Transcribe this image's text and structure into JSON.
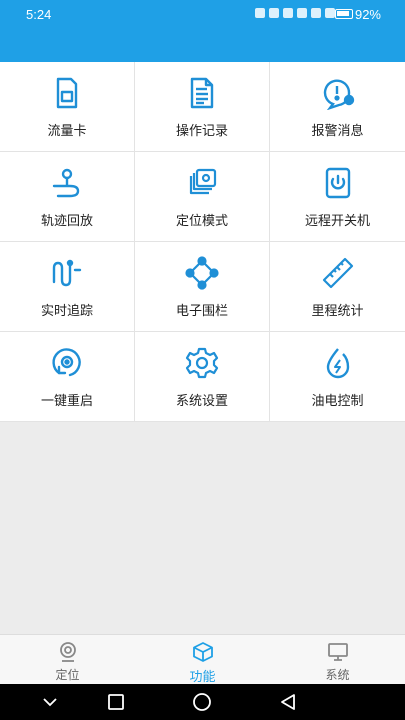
{
  "status_bar": {
    "time": "5:24",
    "battery_percent": "92%"
  },
  "features": [
    {
      "label": "流量卡",
      "icon": "sim-card-icon"
    },
    {
      "label": "操作记录",
      "icon": "document-icon"
    },
    {
      "label": "报警消息",
      "icon": "alarm-message-icon"
    },
    {
      "label": "轨迹回放",
      "icon": "track-playback-icon"
    },
    {
      "label": "定位模式",
      "icon": "location-mode-icon"
    },
    {
      "label": "远程开关机",
      "icon": "power-icon"
    },
    {
      "label": "实时追踪",
      "icon": "realtime-tracking-icon"
    },
    {
      "label": "电子围栏",
      "icon": "geofence-icon"
    },
    {
      "label": "里程统计",
      "icon": "ruler-icon"
    },
    {
      "label": "一键重启",
      "icon": "restart-icon"
    },
    {
      "label": "系统设置",
      "icon": "gear-icon"
    },
    {
      "label": "油电控制",
      "icon": "fuel-power-icon"
    }
  ],
  "tabs": [
    {
      "label": "定位",
      "icon": "location-icon",
      "active": false
    },
    {
      "label": "功能",
      "icon": "cube-icon",
      "active": true
    },
    {
      "label": "系统",
      "icon": "monitor-icon",
      "active": false
    }
  ],
  "colors": {
    "accent": "#1fa0e6",
    "icon": "#1f8fd6"
  }
}
